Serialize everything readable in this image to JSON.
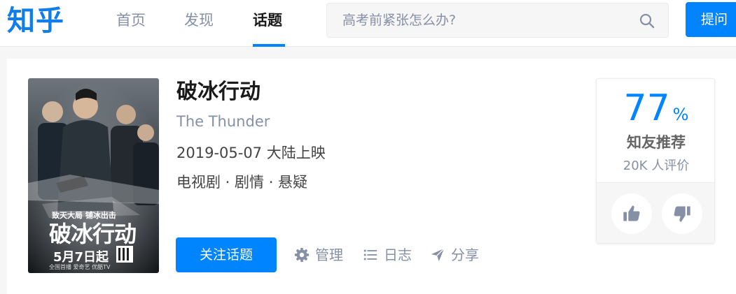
{
  "header": {
    "logo": "知乎",
    "nav": [
      {
        "label": "首页",
        "active": false
      },
      {
        "label": "发现",
        "active": false
      },
      {
        "label": "话题",
        "active": true
      }
    ],
    "search": {
      "placeholder": "高考前紧张怎么办?",
      "icon": "search-icon"
    },
    "ask_button": "提问"
  },
  "topic": {
    "title": "破冰行动",
    "subtitle": "The Thunder",
    "release": "2019-05-07 大陆上映",
    "genres": "电视剧 · 剧情 · 悬疑",
    "follow_button": "关注话题",
    "actions": [
      {
        "label": "管理",
        "icon": "gear-icon"
      },
      {
        "label": "日志",
        "icon": "list-icon"
      },
      {
        "label": "分享",
        "icon": "paper-plane-icon"
      }
    ],
    "poster": {
      "tagline": "致天大局 铺冰出击",
      "title": "破冰行动",
      "date": "5月7日起",
      "broadcasters": "全国首播 爱奇艺 优酷TV"
    }
  },
  "rating": {
    "score": "77",
    "unit": "%",
    "label": "知友推荐",
    "count": "20K 人评价",
    "thumbs_up_icon": "thumbs-up-icon",
    "thumbs_down_icon": "thumbs-down-icon"
  },
  "colors": {
    "brand": "#0084ff",
    "logo": "#0f7dec",
    "muted": "#8590a6",
    "page_bg": "#f6f6f6"
  }
}
